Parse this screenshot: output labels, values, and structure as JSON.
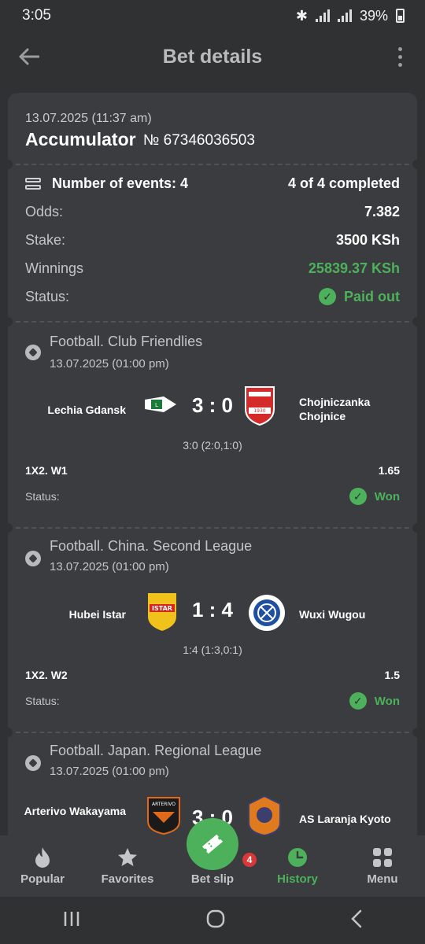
{
  "status_bar": {
    "time": "3:05",
    "battery": "39%"
  },
  "app_bar": {
    "title": "Bet details"
  },
  "bet": {
    "date": "13.07.2025 (11:37 am)",
    "type": "Accumulator",
    "number": "№ 67346036503",
    "events_label": "Number of events: 4",
    "events_completed": "4 of 4 completed",
    "odds_label": "Odds:",
    "odds_value": "7.382",
    "stake_label": "Stake:",
    "stake_value": "3500 KSh",
    "winnings_label": "Winnings",
    "winnings_value": "25839.37 KSh",
    "status_label": "Status:",
    "status_value": "Paid out"
  },
  "events": [
    {
      "league": "Football. Club Friendlies",
      "date": "13.07.2025 (01:00 pm)",
      "home": "Lechia Gdansk",
      "away": "Chojniczanka Chojnice",
      "score": "3 : 0",
      "detail": "3:0 (2:0,1:0)",
      "market": "1X2. W1",
      "odds": "1.65",
      "status_label": "Status:",
      "result": "Won"
    },
    {
      "league": "Football. China. Second League",
      "date": "13.07.2025 (01:00 pm)",
      "home": "Hubei Istar",
      "away": "Wuxi Wugou",
      "score": "1 : 4",
      "detail": "1:4 (1:3,0:1)",
      "market": "1X2. W2",
      "odds": "1.5",
      "status_label": "Status:",
      "result": "Won"
    },
    {
      "league": "Football. Japan. Regional League",
      "date": "13.07.2025 (01:00 pm)",
      "home": "Arterivo Wakayama",
      "away": "AS Laranja Kyoto",
      "score": "3 : 0"
    }
  ],
  "bottom_nav": {
    "popular": "Popular",
    "favorites": "Favorites",
    "bet_slip": "Bet slip",
    "bet_slip_count": "4",
    "history": "History",
    "menu": "Menu"
  },
  "colors": {
    "accent_green": "#4db15b",
    "badge_red": "#d83838",
    "background": "#2f3133",
    "card": "#3a3c3f"
  }
}
